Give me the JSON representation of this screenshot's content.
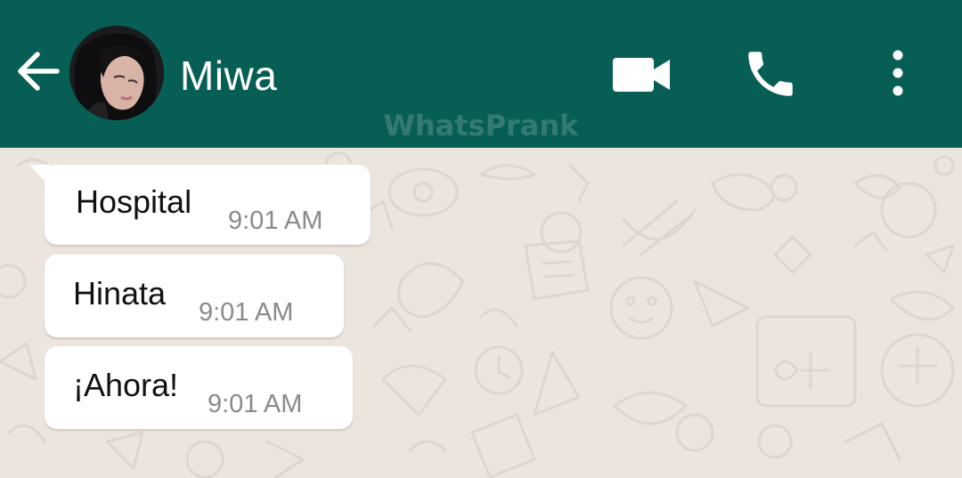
{
  "header": {
    "contact_name": "Miwa",
    "watermark": "WhatsPrank",
    "icons": {
      "back": "arrow-left-icon",
      "video": "video-camera-icon",
      "call": "phone-icon",
      "menu": "more-vertical-icon"
    },
    "colors": {
      "header_bg": "#075E54",
      "icon": "#FFFFFF"
    }
  },
  "chat": {
    "background_color": "#ECE5DD",
    "bubble_color": "#FFFFFF",
    "messages": [
      {
        "text": "Hospital",
        "time": "9:01 AM"
      },
      {
        "text": "Hinata",
        "time": "9:01 AM"
      },
      {
        "text": "¡Ahora!",
        "time": "9:01 AM"
      }
    ]
  }
}
